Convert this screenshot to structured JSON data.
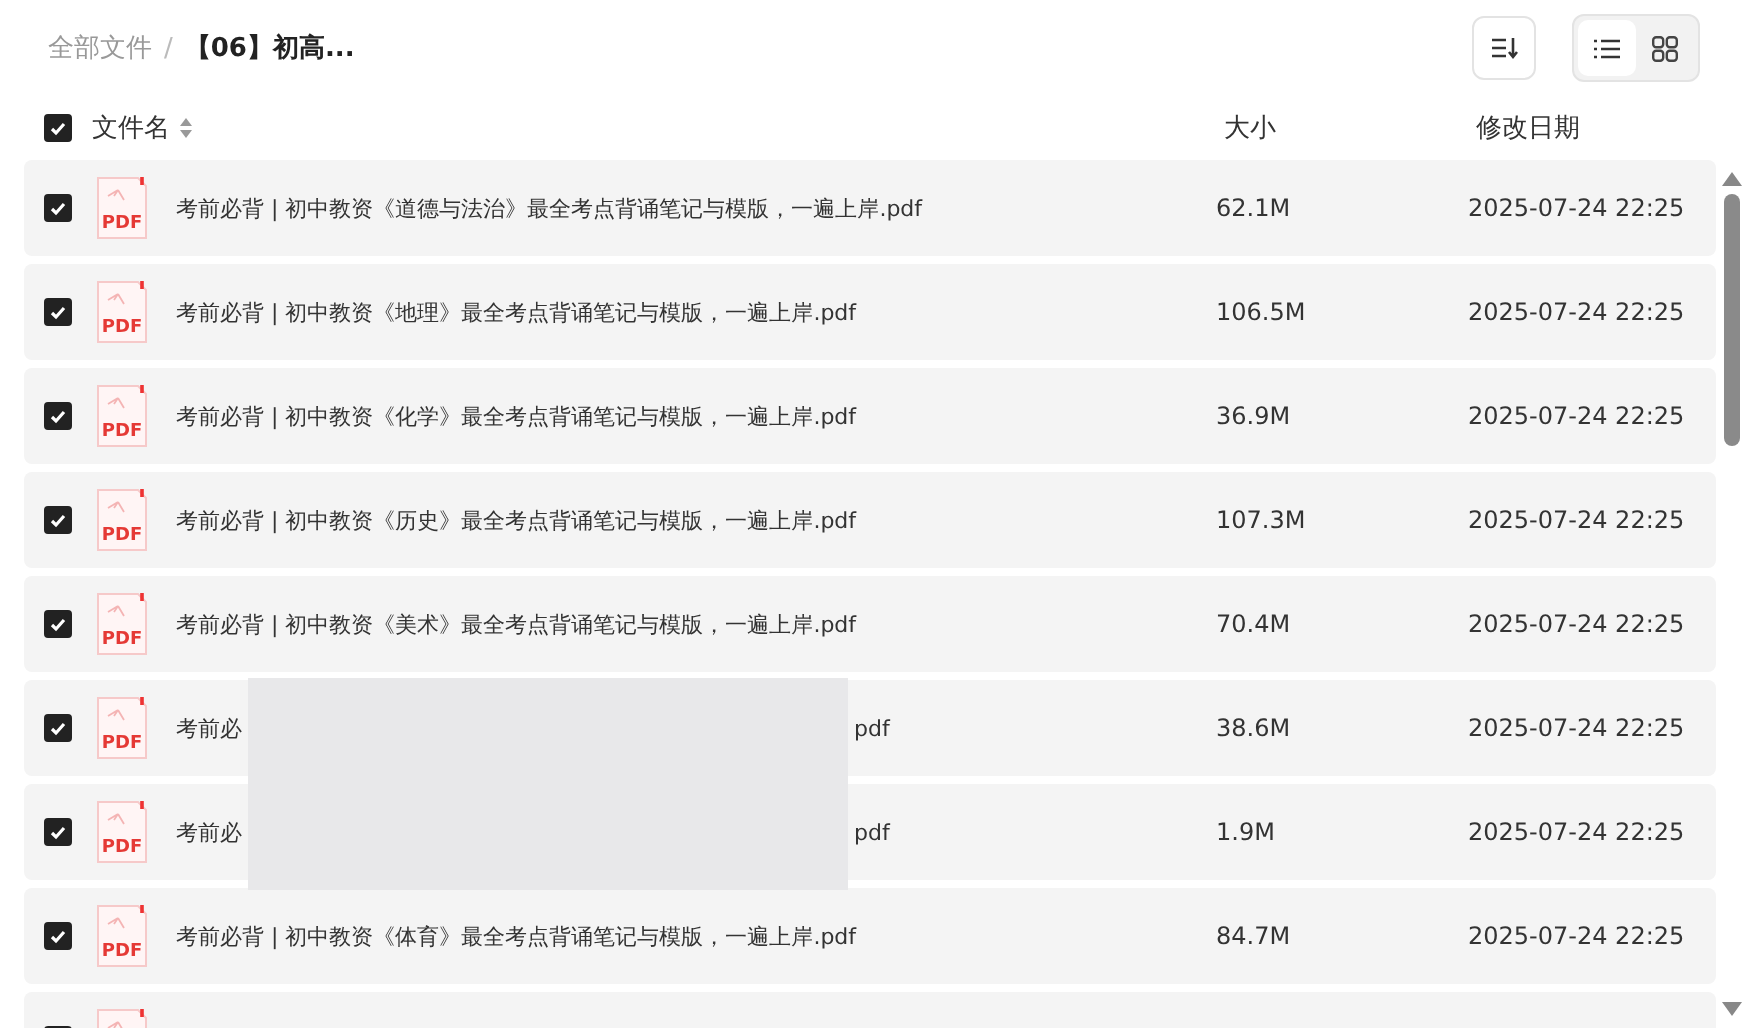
{
  "breadcrumb": [
    {
      "label": "全部文件",
      "current": false
    },
    {
      "label": "【06】初高...",
      "current": true
    }
  ],
  "breadcrumb_separator": "/",
  "view_modes": [
    {
      "kind": "list",
      "selected": true
    },
    {
      "kind": "grid",
      "selected": false
    }
  ],
  "table": {
    "select_all": {
      "checked": true
    },
    "columns": [
      {
        "label": "文件名",
        "kind": "sortable"
      },
      {
        "label": "大小",
        "kind": "plain"
      },
      {
        "label": "修改日期",
        "kind": "plain"
      }
    ],
    "rows": [
      {
        "kind": "full",
        "checked": true,
        "icon_label": "PDF",
        "name": "考前必背 | 初中教资《道德与法治》最全考点背诵笔记与模版，一遍上岸.pdf",
        "size": "62.1M",
        "modified": "2025-07-24 22:25"
      },
      {
        "kind": "full",
        "checked": true,
        "icon_label": "PDF",
        "name": "考前必背 | 初中教资《地理》最全考点背诵笔记与模版，一遍上岸.pdf",
        "size": "106.5M",
        "modified": "2025-07-24 22:25"
      },
      {
        "kind": "full",
        "checked": true,
        "icon_label": "PDF",
        "name": "考前必背 | 初中教资《化学》最全考点背诵笔记与模版，一遍上岸.pdf",
        "size": "36.9M",
        "modified": "2025-07-24 22:25"
      },
      {
        "kind": "full",
        "checked": true,
        "icon_label": "PDF",
        "name": "考前必背 | 初中教资《历史》最全考点背诵笔记与模版，一遍上岸.pdf",
        "size": "107.3M",
        "modified": "2025-07-24 22:25"
      },
      {
        "kind": "full",
        "checked": true,
        "icon_label": "PDF",
        "name": "考前必背 | 初中教资《美术》最全考点背诵笔记与模版，一遍上岸.pdf",
        "size": "70.4M",
        "modified": "2025-07-24 22:25"
      },
      {
        "kind": "obscured",
        "checked": true,
        "icon_label": "PDF",
        "name_start": "考前必",
        "name_end": "pdf",
        "size": "38.6M",
        "modified": "2025-07-24 22:25"
      },
      {
        "kind": "obscured",
        "checked": true,
        "icon_label": "PDF",
        "name_start": "考前必",
        "name_end": "pdf",
        "size": "1.9M",
        "modified": "2025-07-24 22:25"
      },
      {
        "kind": "full",
        "checked": true,
        "icon_label": "PDF",
        "name": "考前必背 | 初中教资《体育》最全考点背诵笔记与模版，一遍上岸.pdf",
        "size": "84.7M",
        "modified": "2025-07-24 22:25"
      },
      {
        "kind": "cut",
        "checked": true
      }
    ]
  }
}
